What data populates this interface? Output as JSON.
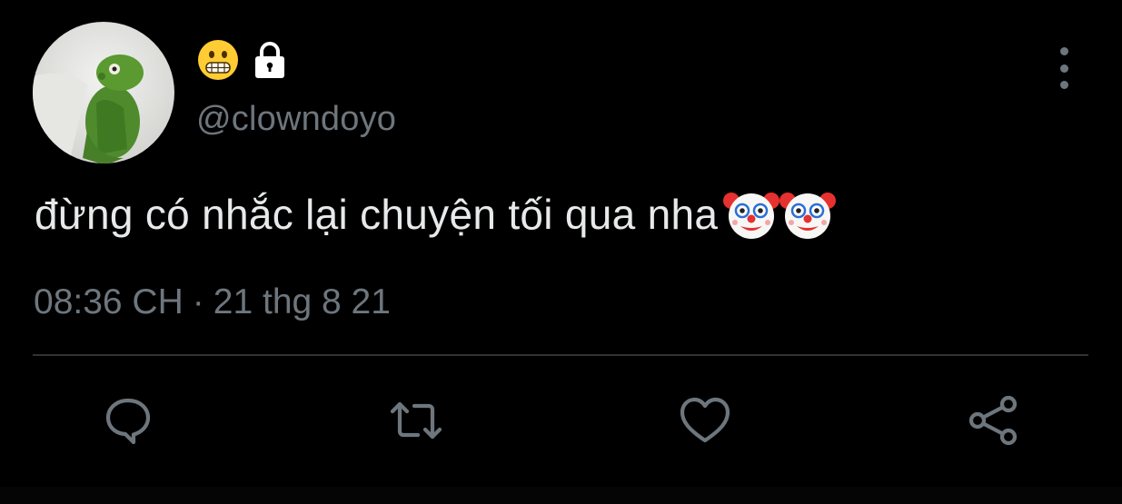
{
  "tweet": {
    "display_name_emoji": "grimacing-face-emoji",
    "protected_icon": "lock-icon",
    "handle": "@clowndoyo",
    "text": "đừng có nhắc lại chuyện tối qua nha",
    "trailing_emojis": [
      "clown-face-emoji",
      "clown-face-emoji"
    ],
    "time": "08:36 CH",
    "separator": "·",
    "date": "21 thg 8 21"
  },
  "actions": [
    {
      "name": "reply",
      "icon": "comment-icon"
    },
    {
      "name": "retweet",
      "icon": "retweet-icon"
    },
    {
      "name": "like",
      "icon": "heart-icon"
    },
    {
      "name": "share",
      "icon": "share-icon"
    }
  ],
  "colors": {
    "background": "#000000",
    "primary_text": "#e7e9ea",
    "secondary_text": "#6e767d",
    "divider": "#2f3336"
  }
}
